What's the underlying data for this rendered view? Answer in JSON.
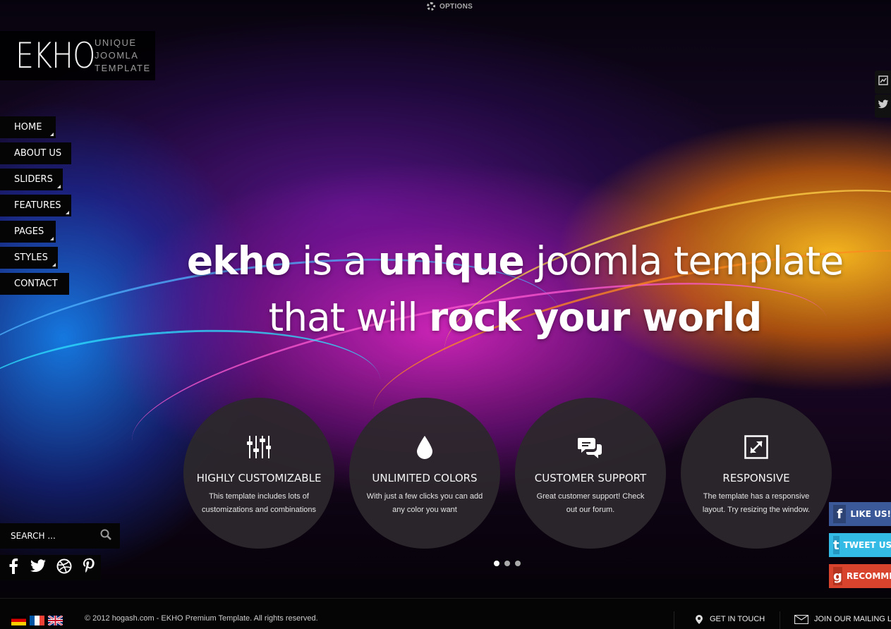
{
  "topbar": {
    "options_label": "OPTIONS"
  },
  "logo": {
    "mark": "EKHO",
    "tagline": [
      "UNIQUE",
      "JOOMLA",
      "TEMPLATE"
    ]
  },
  "nav": {
    "items": [
      {
        "label": "HOME"
      },
      {
        "label": "ABOUT US"
      },
      {
        "label": "SLIDERS"
      },
      {
        "label": "FEATURES"
      },
      {
        "label": "PAGES"
      },
      {
        "label": "STYLES"
      },
      {
        "label": "CONTACT"
      }
    ]
  },
  "hero": {
    "line1": {
      "b1": "ekho",
      "t1": " is a ",
      "b2": "unique",
      "t2": " joomla template"
    },
    "line2": {
      "t1": "that will ",
      "b1": "rock your world"
    }
  },
  "features": [
    {
      "icon": "sliders-icon",
      "title": "HIGHLY CUSTOMIZABLE",
      "text": "This template includes lots of customizations and combinations"
    },
    {
      "icon": "drop-icon",
      "title": "UNLIMITED COLORS",
      "text": "With just a few clicks you can add any color you want"
    },
    {
      "icon": "chat-bubbles-icon",
      "title": "CUSTOMER SUPPORT",
      "text": "Great customer support! Check out our forum."
    },
    {
      "icon": "resize-icon",
      "title": "RESPONSIVE",
      "text": "The template has a responsive layout. Try resizing the window."
    }
  ],
  "slider": {
    "dot_count": 3,
    "active_index": 0
  },
  "search": {
    "placeholder": "SEARCH ..."
  },
  "social_icons": [
    "facebook-icon",
    "twitter-icon",
    "dribbble-icon",
    "pinterest-icon"
  ],
  "share_buttons": [
    {
      "label": "LIKE US!",
      "icon": "facebook-icon",
      "color": "#3b5998"
    },
    {
      "label": "TWEET US",
      "icon": "twitter-icon",
      "color": "#33bbe6"
    },
    {
      "label": "RECOMMEND",
      "icon": "google-plus-icon",
      "color": "#d8432e"
    }
  ],
  "footer": {
    "copyright": "© 2012 hogash.com - EKHO Premium Template. All rights reserved.",
    "get_in_touch": "GET IN TOUCH",
    "mailing": "JOIN OUR MAILING LIST"
  }
}
